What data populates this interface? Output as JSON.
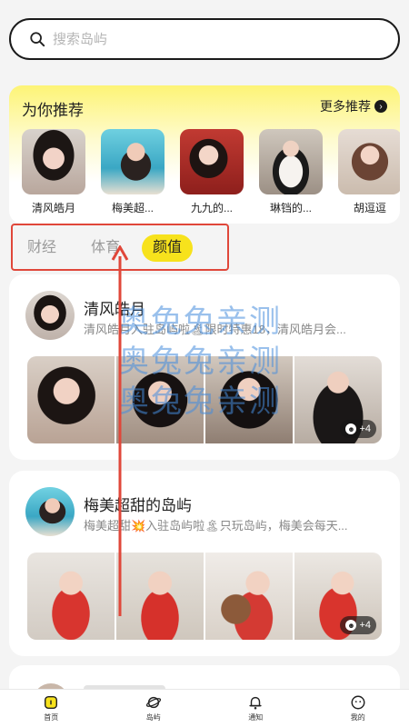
{
  "search": {
    "placeholder": "搜索岛屿"
  },
  "recommend": {
    "title": "为你推荐",
    "more_label": "更多推荐",
    "items": [
      {
        "name": "清风皓月"
      },
      {
        "name": "梅美超..."
      },
      {
        "name": "九九的..."
      },
      {
        "name": "琳铛的..."
      },
      {
        "name": "胡逗逗"
      }
    ]
  },
  "tabs": [
    {
      "label": "财经",
      "active": false
    },
    {
      "label": "体育",
      "active": false
    },
    {
      "label": "颜值",
      "active": true
    }
  ],
  "feed": [
    {
      "name": "清风皓月",
      "desc": "清风皓月入驻岛屿啦🏝限时特惠18，清风皓月会...",
      "more_count": "+4"
    },
    {
      "name": "梅美超甜的岛屿",
      "desc": "梅美超甜💥入驻岛屿啦🏝只玩岛屿，梅美会每天...",
      "more_count": "+4"
    }
  ],
  "watermark": "奥兔兔亲测",
  "bottom_nav": [
    {
      "label": "首页",
      "icon": "home-icon",
      "active": true
    },
    {
      "label": "岛屿",
      "icon": "planet-icon",
      "active": false
    },
    {
      "label": "通知",
      "icon": "bell-icon",
      "active": false
    },
    {
      "label": "我的",
      "icon": "profile-icon",
      "active": false
    }
  ],
  "colors": {
    "accent": "#f7e21c",
    "highlight_box": "#e0473a",
    "watermark": "#468cdc"
  }
}
